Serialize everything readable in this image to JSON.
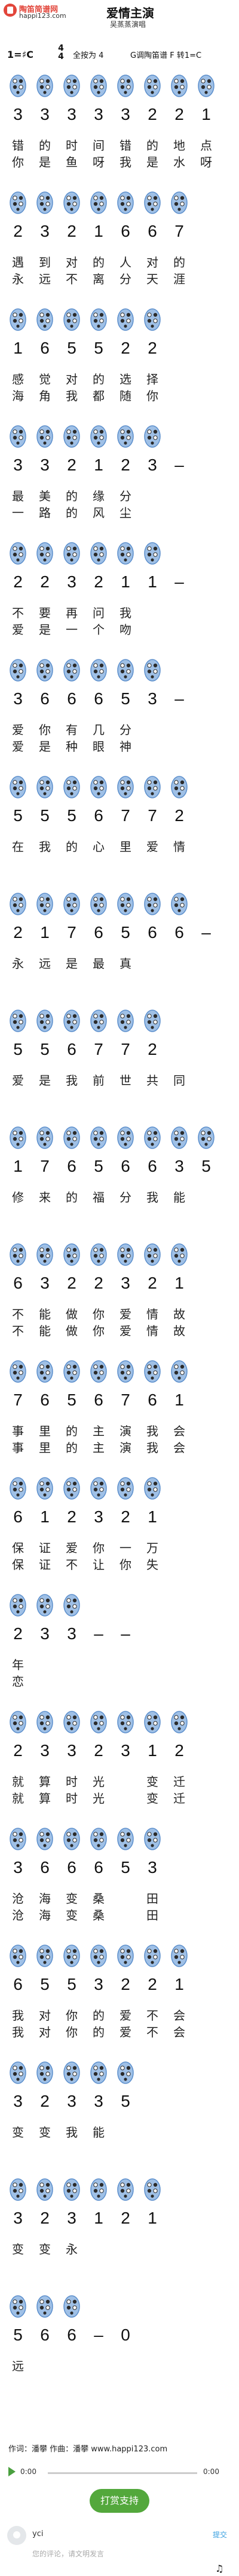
{
  "header": {
    "logo_name": "陶笛简谱网",
    "logo_domain": "happi123.com",
    "song_title": "爱情主演",
    "song_subtitle": "吴蒸蒸演唱"
  },
  "meta": {
    "key": "1=♯C",
    "time_sig_top": "4",
    "time_sig_bottom": "4",
    "fingering": "全按为 4",
    "mode": "G调陶笛谱 F 转1=C"
  },
  "rows": [
    {
      "notes": [
        "3",
        "3",
        "3",
        "3",
        "3",
        "2",
        "2",
        "1"
      ],
      "lyrics1": [
        "错",
        "的",
        "时",
        "间",
        "错",
        "的",
        "地",
        "点"
      ],
      "lyrics2": [
        "你",
        "是",
        "鱼",
        "呀",
        "我",
        "是",
        "水",
        "呀"
      ]
    },
    {
      "notes": [
        "2",
        "3",
        "2",
        "1",
        "6",
        "6",
        "7",
        ""
      ],
      "lyrics1": [
        "遇",
        "到",
        "对",
        "的",
        "人",
        "对",
        "的",
        ""
      ],
      "lyrics2": [
        "永",
        "远",
        "不",
        "离",
        "分",
        "天",
        "涯",
        ""
      ]
    },
    {
      "notes": [
        "1",
        "6",
        "5",
        "5",
        "2",
        "2",
        "",
        ""
      ],
      "lyrics1": [
        "感",
        "觉",
        "对",
        "的",
        "选",
        "择",
        "",
        ""
      ],
      "lyrics2": [
        "海",
        "角",
        "我",
        "都",
        "随",
        "你",
        "",
        ""
      ]
    },
    {
      "notes": [
        "3",
        "3",
        "2",
        "1",
        "2",
        "3",
        "–",
        ""
      ],
      "lyrics1": [
        "最",
        "美",
        "的",
        "缘",
        "分",
        "",
        "",
        ""
      ],
      "lyrics2": [
        "一",
        "路",
        "的",
        "风",
        "尘",
        "",
        "",
        ""
      ]
    },
    {
      "notes": [
        "2",
        "2",
        "3",
        "2",
        "1",
        "1",
        "–",
        ""
      ],
      "lyrics1": [
        "不",
        "要",
        "再",
        "问",
        "我",
        "",
        "",
        ""
      ],
      "lyrics2": [
        "爱",
        "是",
        "一",
        "个",
        "吻",
        "",
        "",
        ""
      ]
    },
    {
      "notes": [
        "3",
        "6",
        "6",
        "6",
        "5",
        "3",
        "–",
        ""
      ],
      "lyrics1": [
        "爱",
        "你",
        "有",
        "几",
        "分",
        "",
        "",
        ""
      ],
      "lyrics2": [
        "爱",
        "是",
        "种",
        "眼",
        "神",
        "",
        "",
        ""
      ]
    },
    {
      "notes": [
        "5",
        "5",
        "5",
        "6",
        "7",
        "7",
        "2",
        ""
      ],
      "lyrics1": [
        "在",
        "我",
        "的",
        "心",
        "里",
        "爱",
        "情",
        ""
      ],
      "lyrics2": [
        "",
        "",
        "",
        "",
        "",
        "",
        "",
        ""
      ]
    },
    {
      "notes": [
        "2",
        "1",
        "7",
        "6",
        "5",
        "6",
        "6",
        "–"
      ],
      "lyrics1": [
        "永",
        "远",
        "是",
        "最",
        "真",
        "",
        "",
        ""
      ],
      "lyrics2": [
        "",
        "",
        "",
        "",
        "",
        "",
        "",
        ""
      ]
    },
    {
      "notes": [
        "5",
        "5",
        "6",
        "7",
        "7",
        "2",
        "",
        ""
      ],
      "lyrics1": [
        "爱",
        "是",
        "我",
        "前",
        "世",
        "共",
        "同",
        ""
      ],
      "lyrics2": [
        "",
        "",
        "",
        "",
        "",
        "",
        "",
        ""
      ]
    },
    {
      "notes": [
        "1",
        "7",
        "6",
        "5",
        "6",
        "6",
        "3",
        "5"
      ],
      "lyrics1": [
        "修",
        "来",
        "的",
        "福",
        "分",
        "我",
        "能",
        ""
      ],
      "lyrics2": [
        "",
        "",
        "",
        "",
        "",
        "",
        "",
        ""
      ]
    },
    {
      "notes": [
        "6",
        "3",
        "2",
        "2",
        "3",
        "2",
        "1",
        ""
      ],
      "lyrics1": [
        "不",
        "能",
        "做",
        "你",
        "爱",
        "情",
        "故",
        ""
      ],
      "lyrics2": [
        "不",
        "能",
        "做",
        "你",
        "爱",
        "情",
        "故",
        ""
      ]
    },
    {
      "notes": [
        "7",
        "6",
        "5",
        "6",
        "7",
        "6",
        "1",
        ""
      ],
      "lyrics1": [
        "事",
        "里",
        "的",
        "主",
        "演",
        "我",
        "会",
        ""
      ],
      "lyrics2": [
        "事",
        "里",
        "的",
        "主",
        "演",
        "我",
        "会",
        ""
      ]
    },
    {
      "notes": [
        "6",
        "1",
        "2",
        "3",
        "2",
        "1",
        ""
      ],
      "lyrics1": [
        "保",
        "证",
        "爱",
        "你",
        "一",
        "万",
        ""
      ],
      "lyrics2": [
        "保",
        "证",
        "不",
        "让",
        "你",
        "失",
        ""
      ]
    },
    {
      "notes": [
        "2",
        "3",
        "3",
        "–",
        "–",
        ""
      ],
      "lyrics1": [
        "年",
        "",
        "",
        "",
        "",
        ""
      ],
      "lyrics2": [
        "恋",
        "",
        "",
        "",
        "",
        ""
      ]
    },
    {
      "notes": [
        "2",
        "3",
        "3",
        "2",
        "3",
        "1",
        "2",
        ""
      ],
      "lyrics1": [
        "就",
        "算",
        "时",
        "光",
        "",
        "变",
        "迁",
        ""
      ],
      "lyrics2": [
        "就",
        "算",
        "时",
        "光",
        "",
        "变",
        "迁",
        ""
      ]
    },
    {
      "notes": [
        "3",
        "6",
        "6",
        "6",
        "5",
        "3",
        ""
      ],
      "lyrics1": [
        "沧",
        "海",
        "变",
        "桑",
        "",
        "田",
        ""
      ],
      "lyrics2": [
        "沧",
        "海",
        "变",
        "桑",
        "",
        "田",
        ""
      ]
    },
    {
      "notes": [
        "6",
        "5",
        "5",
        "3",
        "2",
        "2",
        "1",
        ""
      ],
      "lyrics1": [
        "我",
        "对",
        "你",
        "的",
        "爱",
        "不",
        "会",
        ""
      ],
      "lyrics2": [
        "我",
        "对",
        "你",
        "的",
        "爱",
        "不",
        "会",
        ""
      ]
    },
    {
      "notes": [
        "3",
        "2",
        "3",
        "3",
        "5",
        "",
        ""
      ],
      "lyrics1": [
        "变",
        "变",
        "我",
        "能",
        "",
        "",
        ""
      ],
      "lyrics2": [
        "",
        "",
        "",
        "",
        "",
        "",
        ""
      ]
    },
    {
      "notes": [
        "3",
        "2",
        "3",
        "1",
        "2",
        "1",
        ""
      ],
      "lyrics1": [
        "变",
        "变",
        "永",
        "",
        "",
        "",
        ""
      ],
      "lyrics2": [
        "",
        "",
        "",
        "",
        "",
        "",
        ""
      ]
    },
    {
      "notes": [
        "5",
        "6",
        "6",
        "–",
        "0",
        "",
        ""
      ],
      "lyrics1": [
        "远",
        "",
        "",
        "",
        "",
        "",
        ""
      ],
      "lyrics2": [
        "",
        "",
        "",
        "",
        "",
        "",
        ""
      ]
    }
  ],
  "footer": {
    "credits": "作词：潘攀   作曲：潘攀 www.happi123.com",
    "time_start": "0:00",
    "time_end": "0:00",
    "tip_button": "打赏支持",
    "user": "yci",
    "comment_link": "提交",
    "placeholder": "您的评论，请文明发言",
    "music_icon": "♫"
  },
  "colors": {
    "hole": "#9fc0e6",
    "hole_border": "#5c8fcc",
    "tip_button_bg": "#53a83c"
  }
}
